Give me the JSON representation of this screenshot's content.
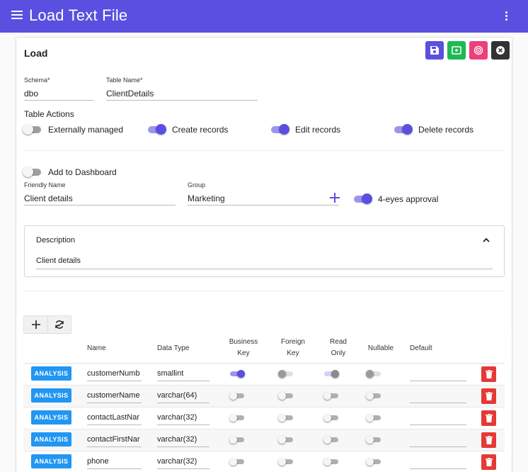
{
  "app": {
    "title": "Load Text File"
  },
  "card": {
    "title": "Load"
  },
  "actions": {
    "save_color": "#5a4fe0",
    "preview_color": "#1db954",
    "monitor_color": "#ec407a",
    "close_color": "#333333"
  },
  "schema": {
    "label": "Schema*",
    "value": "dbo"
  },
  "table_name": {
    "label": "Table Name*",
    "value": "ClientDetails"
  },
  "table_actions": {
    "label": "Table Actions",
    "externally_managed": "Externally managed",
    "create_records": "Create records",
    "edit_records": "Edit records",
    "delete_records": "Delete records"
  },
  "dashboard": {
    "add_label": "Add to Dashboard"
  },
  "friendly_name": {
    "label": "Friendly Name",
    "value": "Client details"
  },
  "group": {
    "label": "Group",
    "value": "Marketing"
  },
  "four_eyes": {
    "label": "4-eyes approval"
  },
  "description": {
    "header": "Description",
    "value": "Client details"
  },
  "grid": {
    "headers": {
      "name": "Name",
      "data_type": "Data Type",
      "business_key_1": "Business",
      "business_key_2": "Key",
      "foreign_key_1": "Foreign",
      "foreign_key_2": "Key",
      "read_only_1": "Read",
      "read_only_2": "Only",
      "nullable": "Nullable",
      "default": "Default"
    },
    "analysis_label": "ANALYSIS",
    "rows": [
      {
        "name": "customerNumb",
        "type": "smallint"
      },
      {
        "name": "customerName",
        "type": "varchar(64)"
      },
      {
        "name": "contactLastNar",
        "type": "varchar(32)"
      },
      {
        "name": "contactFirstNar",
        "type": "varchar(32)"
      },
      {
        "name": "phone",
        "type": "varchar(32)"
      }
    ]
  }
}
